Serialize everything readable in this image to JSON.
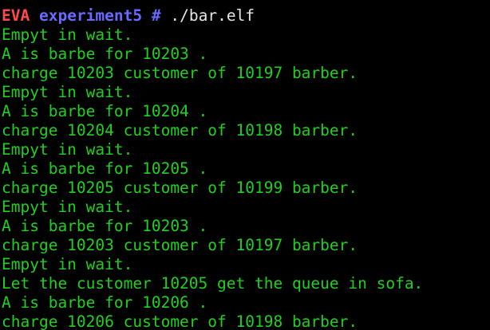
{
  "window": {
    "type": "terminal"
  },
  "colors": {
    "background": "#000000",
    "output": "#1fd01f",
    "host": "#ff4a4a",
    "directory": "#6a6aff",
    "command": "#e6e6e6"
  },
  "prompt": {
    "host": "EVA",
    "directory": "experiment5",
    "symbol": "#",
    "command": "./bar.elf"
  },
  "output_lines": [
    "Empyt in wait.",
    "A is barbe for 10203 .",
    "charge 10203 customer of 10197 barber.",
    "Empyt in wait.",
    "A is barbe for 10204 .",
    "charge 10204 customer of 10198 barber.",
    "Empyt in wait.",
    "A is barbe for 10205 .",
    "charge 10205 customer of 10199 barber.",
    "Empyt in wait.",
    "A is barbe for 10203 .",
    "charge 10203 customer of 10197 barber.",
    "Empyt in wait.",
    "Let the customer 10205 get the queue in sofa.",
    "A is barbe for 10206 .",
    "charge 10206 customer of 10198 barber."
  ]
}
